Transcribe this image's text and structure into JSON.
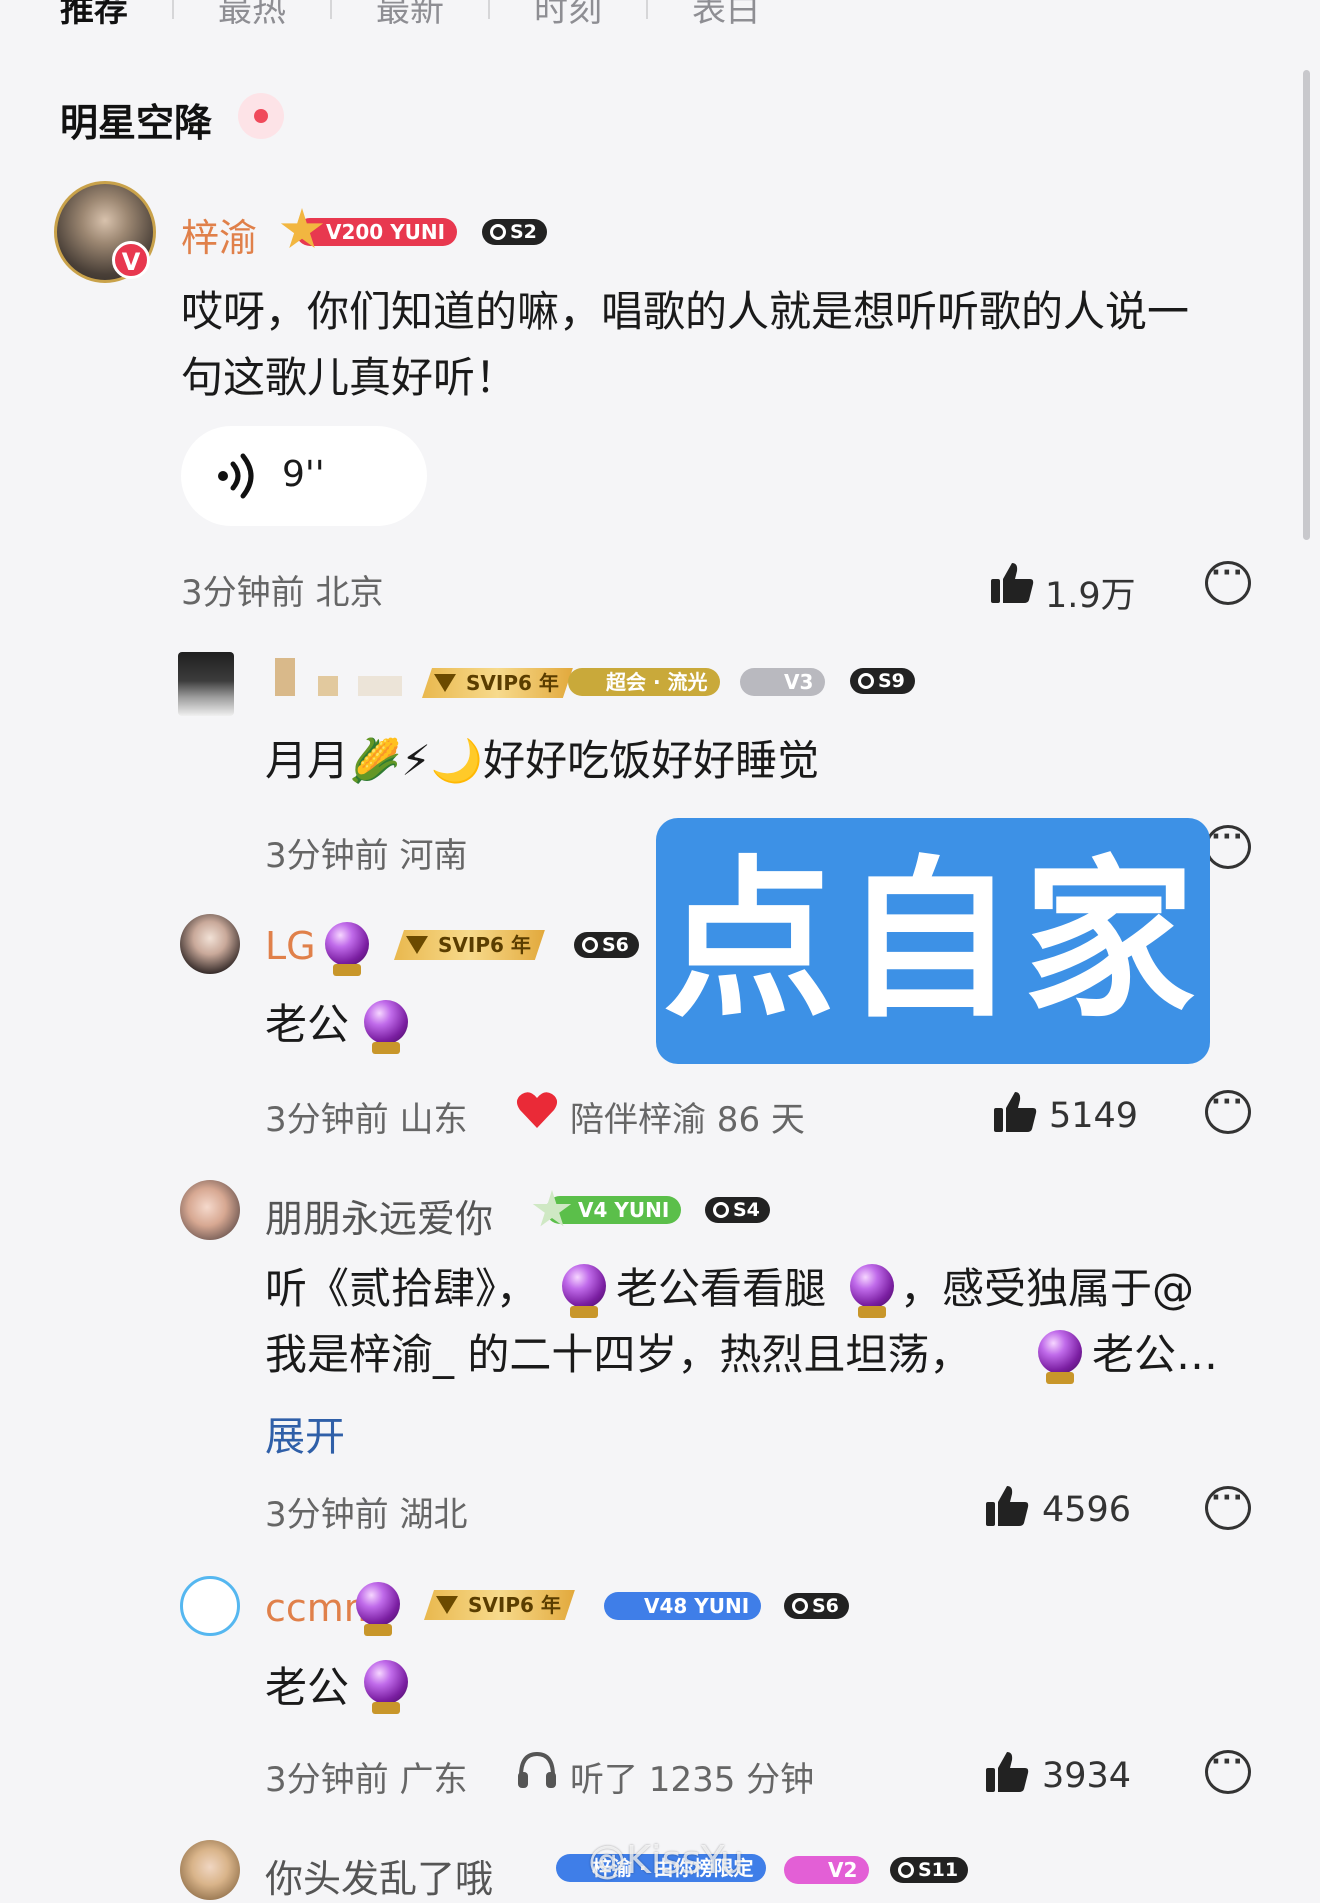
{
  "tabs": [
    "推荐",
    "最热",
    "最新",
    "时刻",
    "表白"
  ],
  "section": {
    "title": "明星空降"
  },
  "voice_message": {
    "duration": "9''"
  },
  "comments": [
    {
      "user": "梓渝",
      "badges": {
        "fan_level": "V200 YUNI",
        "season": "S2"
      },
      "text_line1": "哎呀，你们知道的嘛，唱歌的人就是想听听歌的人说一",
      "text_line2": "句这歌儿真好听！",
      "time": "3分钟前 北京",
      "likes": "1.9万"
    },
    {
      "user": "",
      "badges": {
        "svip": "SVIP6 年",
        "club": "超会 · 流光",
        "vip": "V3",
        "season": "S9"
      },
      "text": "月月🌽⚡🌙好好吃饭好好睡觉",
      "time": "3分钟前 河南"
    },
    {
      "user": "LG",
      "badges": {
        "svip": "SVIP6 年",
        "season": "S6"
      },
      "text": "老公",
      "time": "3分钟前 山东",
      "companion": "陪伴梓渝 86 天",
      "likes": "5149"
    },
    {
      "user": "朋朋永远爱你",
      "badges": {
        "fan_level": "V4 YUNI",
        "season": "S4"
      },
      "text_line1a": "听《贰拾肆》，",
      "text_line1b": "老公看看腿",
      "text_line1c": "，感受独属于@",
      "text_line2a": "我是梓渝_ 的二十四岁，热烈且坦荡，",
      "text_line2b": "老公…",
      "expand": "展开",
      "time": "3分钟前 湖北",
      "likes": "4596"
    },
    {
      "user": "ccmm",
      "badges": {
        "svip": "SVIP6 年",
        "fan_level": "V48 YUNI",
        "season": "S6"
      },
      "text": "老公",
      "time": "3分钟前 广东",
      "listened": "听了 1235 分钟",
      "likes": "3934"
    },
    {
      "user": "你头发乱了哦",
      "badges": {
        "fan_level": "梓渝 · 由你榜限定",
        "vip": "V2",
        "season": "S11"
      }
    }
  ],
  "overlay": {
    "text": "点自家"
  },
  "watermark": "@KissYu",
  "colors": {
    "vip_username": "#e0804a",
    "link": "#2f5fa8",
    "overlay": "#3d91e6",
    "fan_badge_red": "#e8384f",
    "fan_badge_green": "#5bbf4a",
    "fan_badge_blue": "#3f7ee8"
  },
  "icons": [
    "voice-wave-icon",
    "thumbs-up-icon",
    "reply-icon",
    "heart-icon",
    "headphones-icon",
    "crystal-ball-icon"
  ]
}
